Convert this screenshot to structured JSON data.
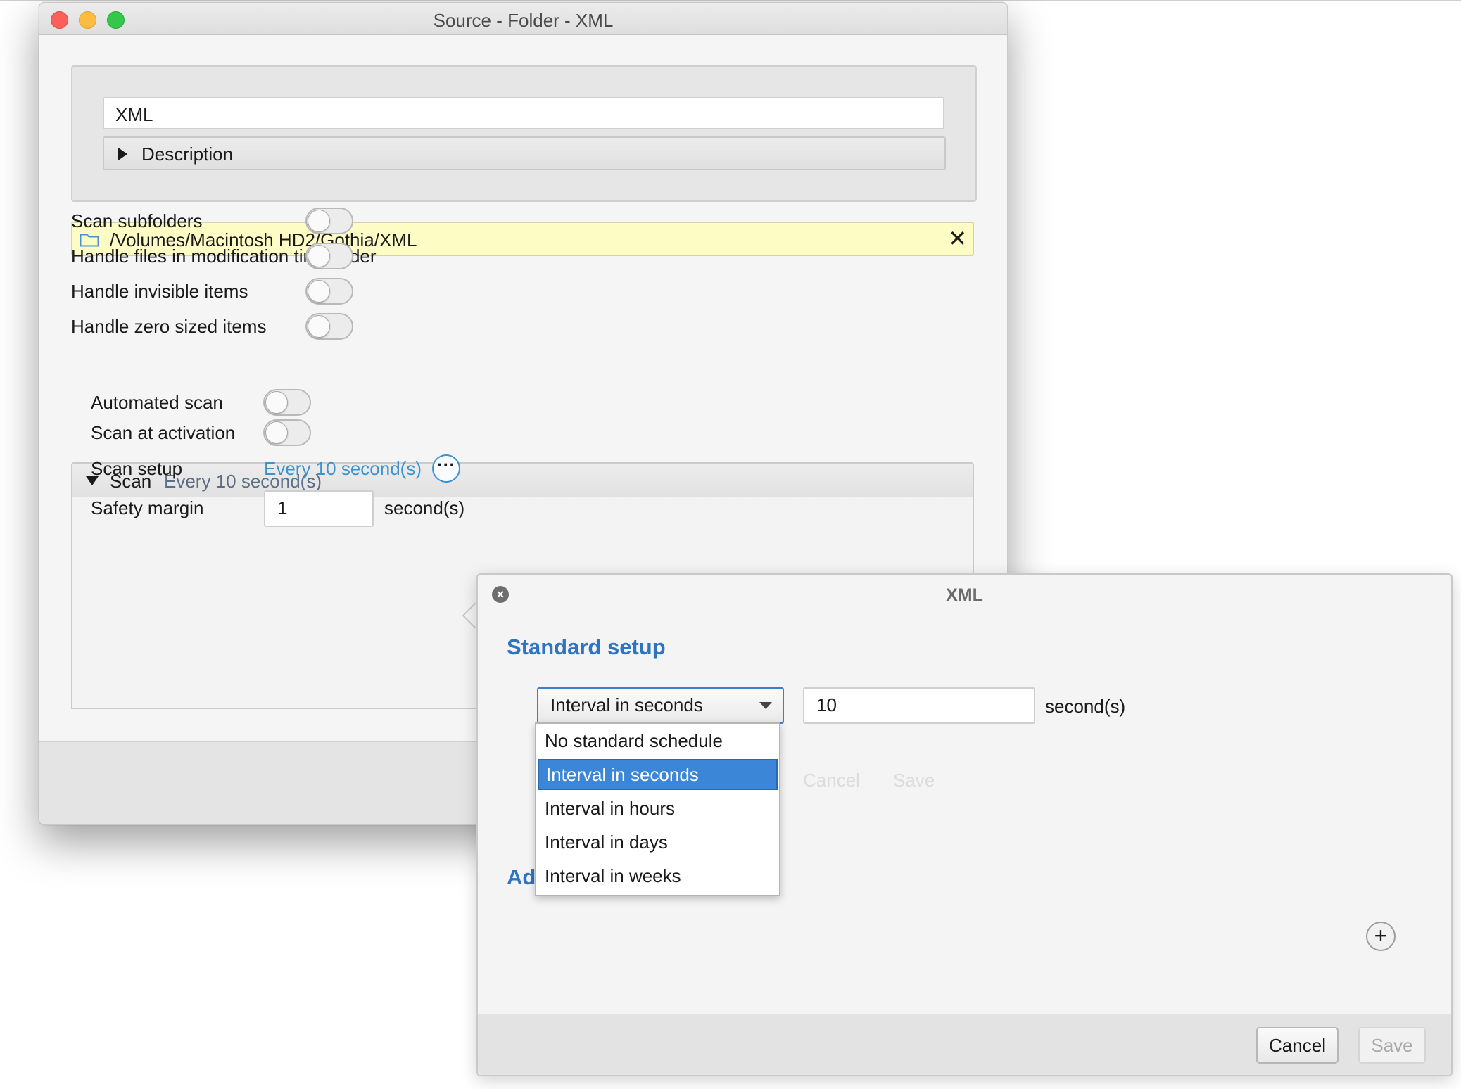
{
  "window": {
    "title": "Source - Folder - XML"
  },
  "name_field": {
    "value": "XML"
  },
  "description": {
    "label": "Description"
  },
  "folder": {
    "path": "/Volumes/Macintosh HD2/Gothia/XML"
  },
  "options": [
    {
      "label": "Scan subfolders",
      "on": false
    },
    {
      "label": "Handle files in modification time order",
      "on": false
    },
    {
      "label": "Handle invisible items",
      "on": false
    },
    {
      "label": "Handle zero sized items",
      "on": false
    }
  ],
  "scan": {
    "label": "Scan",
    "summary": "Every 10 second(s)",
    "automated_scan_label": "Automated scan",
    "automated_scan_on": false,
    "scan_at_activation_label": "Scan at activation",
    "scan_at_activation_on": false,
    "scan_setup_label": "Scan setup",
    "scan_setup_value": "Every 10 second(s)",
    "more_glyph": "···",
    "safety_margin_label": "Safety margin",
    "safety_margin_value": "1",
    "safety_margin_unit": "second(s)"
  },
  "popover": {
    "title": "XML",
    "close_glyph": "×",
    "standard_setup_heading": "Standard setup",
    "advanced_heading_partial": "Ad",
    "schedule_selected": "Interval in seconds",
    "interval_value": "10",
    "interval_unit": "second(s)",
    "schedule_options": [
      "No standard schedule",
      "Interval in seconds",
      "Interval in hours",
      "Interval in days",
      "Interval in weeks"
    ],
    "selected_option_index": 1,
    "ghost_cancel": "Cancel",
    "ghost_save": "Save",
    "add_glyph": "+",
    "cancel_label": "Cancel",
    "save_label": "Save"
  },
  "colors": {
    "accent_blue": "#2f74c0",
    "link_blue": "#3a93cf",
    "selection_blue": "#3b86d6",
    "path_highlight": "#fdfcc4"
  }
}
